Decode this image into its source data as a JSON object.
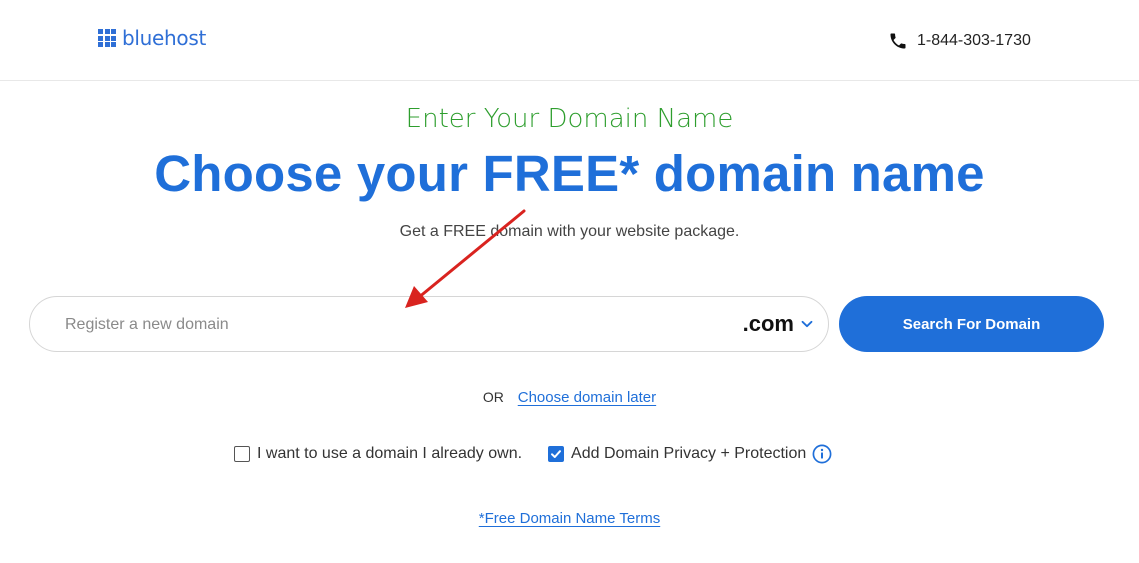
{
  "header": {
    "logo_text": "bluehost",
    "phone": "1-844-303-1730"
  },
  "hero": {
    "eyebrow": "Enter Your Domain Name",
    "headline": "Choose your FREE* domain name",
    "subhead": "Get a FREE domain with your website package."
  },
  "search": {
    "placeholder": "Register a new domain",
    "value": "",
    "tld": ".com",
    "button_label": "Search For Domain"
  },
  "alt": {
    "or_text": "OR",
    "choose_later_label": "Choose domain later"
  },
  "options": {
    "own_domain": {
      "label": "I want to use a domain I already own.",
      "checked": false
    },
    "privacy": {
      "label": "Add Domain Privacy + Protection",
      "checked": true
    }
  },
  "footer": {
    "terms_label": "*Free Domain Name Terms"
  },
  "colors": {
    "brand_blue": "#1f6fd9",
    "eyebrow_green": "#2e9e2e",
    "annotation_red": "#d9231f"
  }
}
